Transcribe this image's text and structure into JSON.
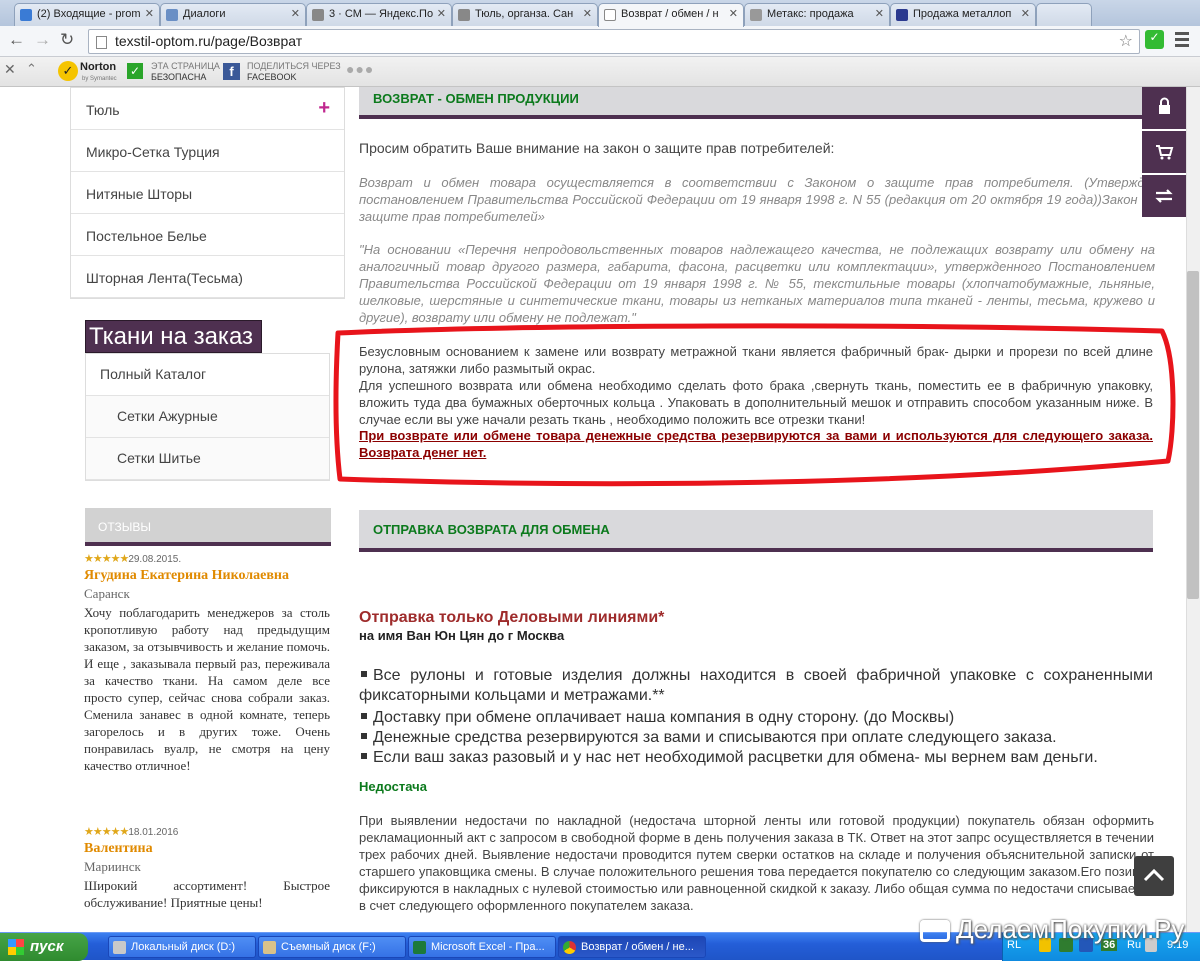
{
  "browser": {
    "tabs": [
      {
        "title": "(2) Входящие - prom",
        "color": "#3a7bd5"
      },
      {
        "title": "Диалоги",
        "color": "#3a7bd5"
      },
      {
        "title": "3 · СМ — Яндекс.По",
        "color": "#777"
      },
      {
        "title": "Тюль, органза. Сан",
        "color": "#777"
      },
      {
        "title": "Возврат / обмен / н",
        "color": "#4e3050",
        "active": true
      },
      {
        "title": "Метакс: продажа",
        "color": "#555"
      },
      {
        "title": "Продажа металлоп",
        "color": "#2b3a8f"
      }
    ],
    "url": "texstil-optom.ru/page/Возврат",
    "toolbar": {
      "norton_brand": "Norton",
      "norton_sub": "by Symantec",
      "safe_line1": "ЭТА СТРАНИЦА",
      "safe_line2": "БЕЗОПАСНА",
      "fb_line1": "ПОДЕЛИТЬСЯ ЧЕРЕЗ",
      "fb_line2": "FACEBOOK"
    }
  },
  "sidebar": {
    "categories": [
      "Тюль",
      "Микро-Сетка Турция",
      "Нитяные Шторы",
      "Постельное Белье",
      "Шторная Лента(Тесьма)"
    ],
    "custom_title": "Ткани на заказ",
    "custom_items": [
      {
        "label": "Полный Каталог",
        "sub": false
      },
      {
        "label": "Сетки Ажурные",
        "sub": true
      },
      {
        "label": "Сетки Шитье",
        "sub": true
      }
    ],
    "reviews_title": "ОТЗЫВЫ",
    "reviews": [
      {
        "stars": 5,
        "date": "29.08.2015.",
        "name": "Ягудина Екатерина Николаевна",
        "city": "Саранск",
        "text": "Хочу поблагодарить менеджеров за столь кропотливую работу над предыдущим заказом, за отзывчивость и желание помочь. И еще , заказывала первый раз, переживала за качество ткани. На самом деле все просто супер, сейчас снова собрали заказ. Сменила занавес в одной комнате, теперь загорелось и в других тоже. Очень понравилась вуалр, не смотря на цену качество отличное!"
      },
      {
        "stars": 5,
        "date": "18.01.2016",
        "name": "Валентина",
        "city": "Мариинск",
        "text": "Широкий ассортимент! Быстрое обслуживание! Приятные цены!"
      }
    ]
  },
  "main": {
    "return_title": "ВОЗВРАТ - ОБМЕН ПРОДУКЦИИ",
    "intro": "Просим обратить Ваше внимание на закон о защите прав потребителей:",
    "law1": "Возврат и обмен товара осуществляется в соответствии с Законом о защите прав потребителя. (Утвержден постановлением Правительства Российской Федерации от 19 января 1998 г. N 55 (редакция от 20 октября 19 года))Закон «О защите прав потребителей»",
    "law2": "\"На основании «Перечня непродовольственных товаров надлежащего качества, не подлежащих возврату или обмену на аналогичный товар другого размера, габарита, фасона, расцветки или комплектации», утвержденного Постановлением Правительства Российской Федерации от 19 января 1998 г. № 55, текстильные товары (хлопчатобумажные, льняные, шелковые, шерстяные и синтетические ткани, товары из нетканых материалов типа тканей - ленты, тесьма, кружево и другие), возврату или обмену не подлежат.\"",
    "boxed_p1": " Безусловным основанием к замене или возврату метражной ткани является фабричный брак- дырки и прорези по всей длине рулона, затяжки либо размытый окрас.",
    "boxed_p2": "Для успешного возврата или обмена необходимо  сделать  фото брака ,свернуть ткань, поместить ее в фабричную упаковку,  вложить туда два бумажных оберточных кольца . Упаковать в дополнительный мешок и отправить способом указанным ниже. В случае если вы уже начали резать ткань , необходимо положить все отрезки ткани!",
    "boxed_warning": "При возврате или обмене товара денежные средства резервируются за вами и используются для следующего заказа. Возврата денег нет.",
    "ship_title": "ОТПРАВКА  ВОЗВРАТА  ДЛЯ ОБМЕНА",
    "ship_carrier": "Отправка только Деловыми линиями*",
    "ship_recipient": "на имя   Ван Юн Цян до г Москва",
    "ship_points": [
      "Все рулоны и готовые изделия должны находится в своей фабричной упаковке с сохраненными фиксаторными кольцами и метражами.**",
      "Доставку при обмене оплачивает наша компания в одну сторону. (до Москвы)",
      "Денежные средства резервируются за вами и списываются при оплате следующего заказа.",
      "Если ваш заказ разовый и у нас нет необходимой расцветки для обмена- мы вернем вам деньги."
    ],
    "shortage_title": "Недостача",
    "shortage_text": "При выявлении недостачи по накладной (недостача шторной ленты или готовой продукции) покупатель обязан оформить рекламационный акт с запросом в свободной форме в день получения заказа в ТК. Ответ на этот запрс осуществляется в течении трех рабочих дней. Выявление недостачи проводится путем сверки остатков на складе и получения объяснительной записки от старшего упаковщика смены. В случае положительного решения това передается покупателю со следующим заказом.Его позиции фиксируются в накладных с нулевой стоимостью или равноценной скидкой к заказу. Либо общая сумма по недостачи списывается в счет следующего оформленного покупателем заказа."
  },
  "taskbar": {
    "start": "пуск",
    "tasks": [
      "Локальный диск (D:)",
      "Съемный диск (F:)",
      "Microsoft Excel - Пра...",
      "Возврат / обмен / не..."
    ],
    "lang": "RL",
    "badge": "36",
    "locale": "Ru",
    "time": "9:19"
  },
  "watermark": "ДелаемПокупки.Ру",
  "colors": {
    "accent": "#4e3050",
    "green_heading": "#0c7a1d",
    "warning_red": "#8b0000",
    "annotation_red": "#e8141b"
  }
}
